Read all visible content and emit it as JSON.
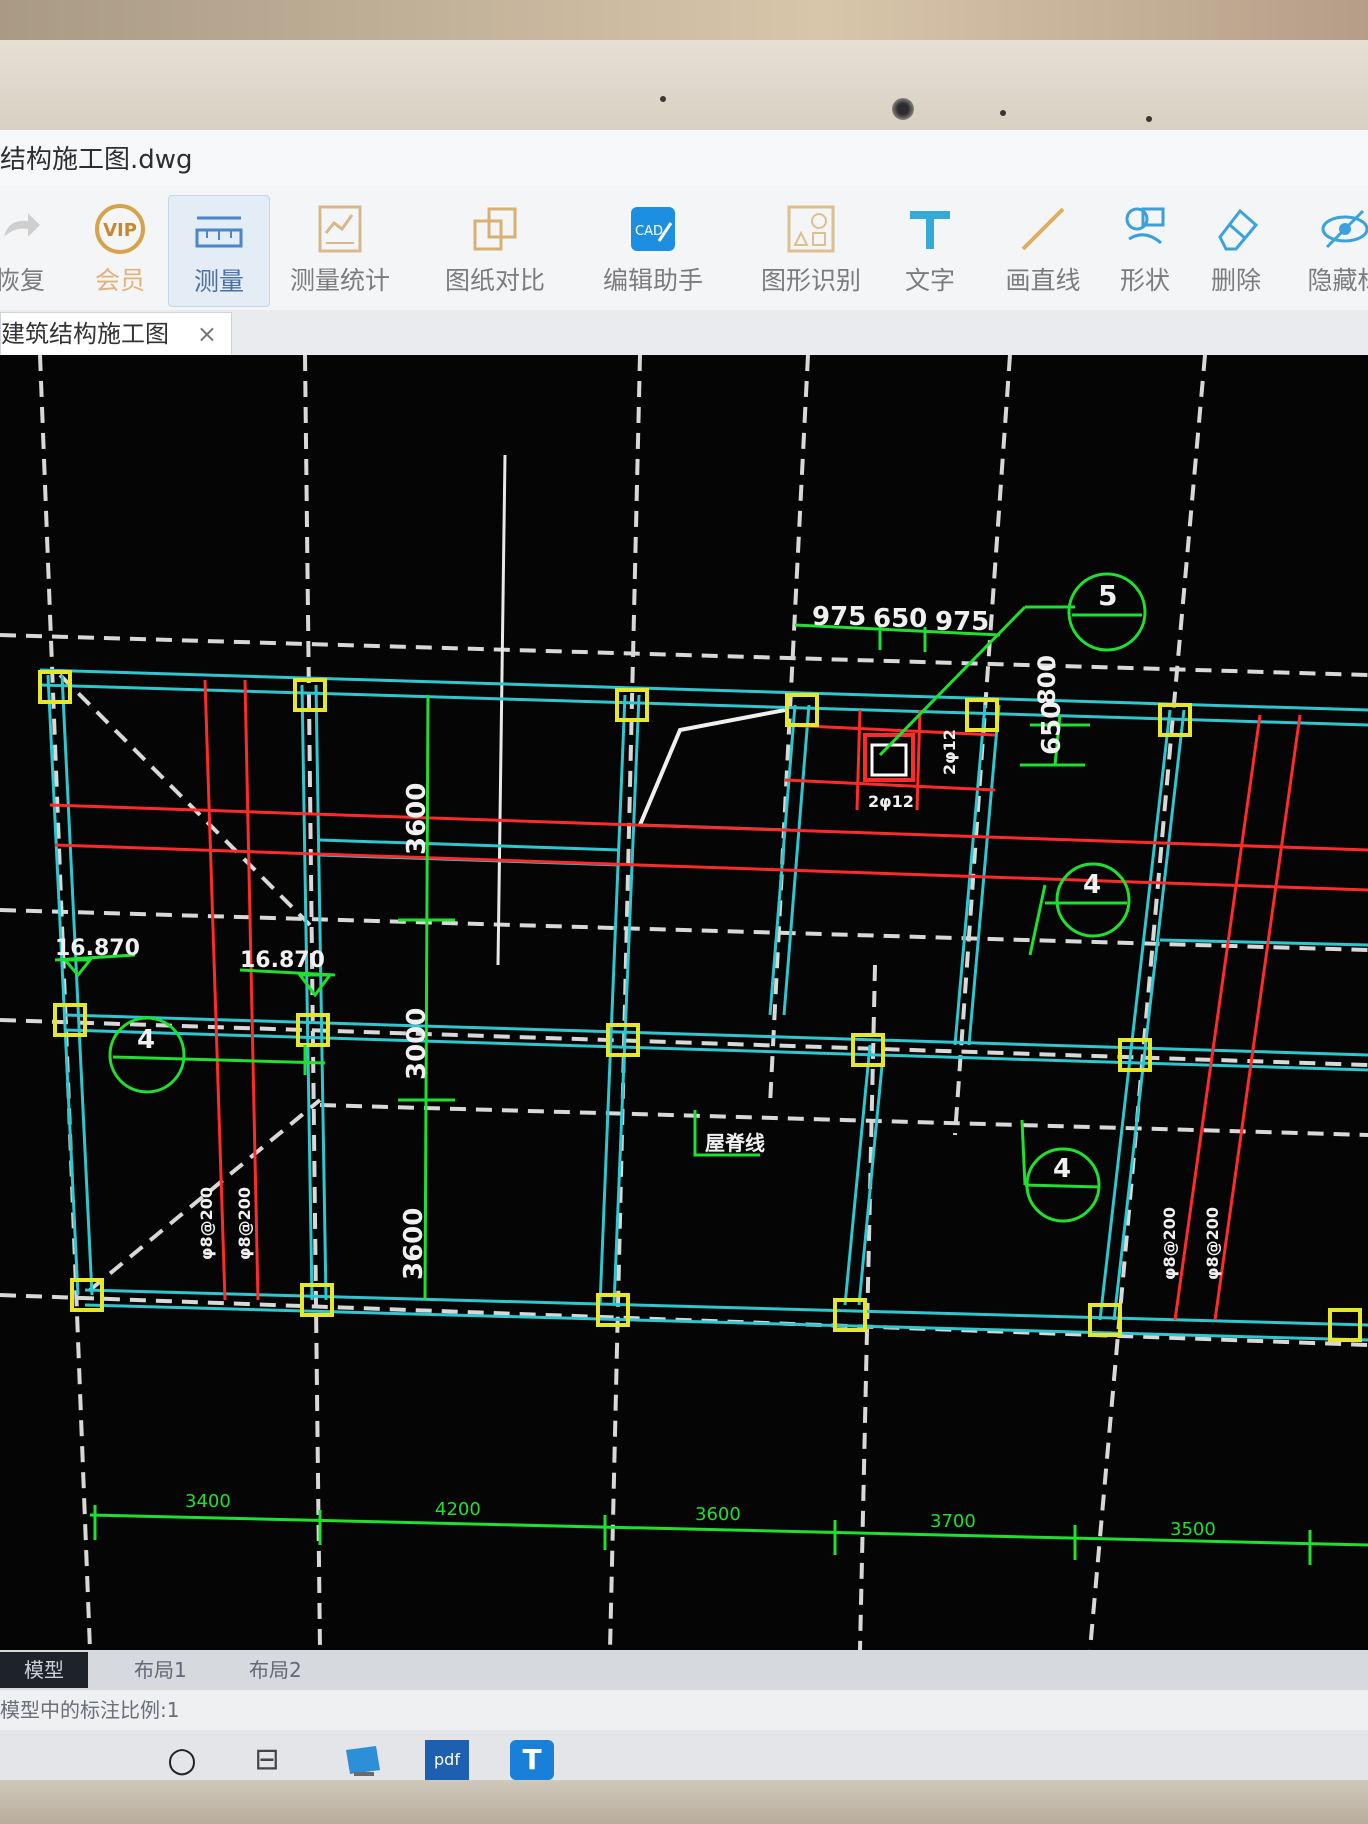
{
  "window": {
    "title": "结构施工图.dwg"
  },
  "toolbar": {
    "items": [
      {
        "label": "恢复",
        "icon": "redo-icon"
      },
      {
        "label": "会员",
        "icon": "vip-icon",
        "badge": "VIP"
      },
      {
        "label": "测量",
        "icon": "ruler-icon",
        "active": true
      },
      {
        "label": "测量统计",
        "icon": "measure-stats-icon"
      },
      {
        "label": "图纸对比",
        "icon": "compare-icon"
      },
      {
        "label": "编辑助手",
        "icon": "edit-assistant-icon",
        "badge": "CAD"
      },
      {
        "label": "图形识别",
        "icon": "shape-recognition-icon"
      },
      {
        "label": "文字",
        "icon": "text-icon"
      },
      {
        "label": "画直线",
        "icon": "line-icon"
      },
      {
        "label": "形状",
        "icon": "shapes-icon"
      },
      {
        "label": "删除",
        "icon": "eraser-icon"
      },
      {
        "label": "隐藏标",
        "icon": "hide-icon"
      }
    ]
  },
  "document_tab": {
    "label": "建筑结构施工图",
    "close": "×"
  },
  "drawing": {
    "dims_top": [
      "975",
      "650",
      "975"
    ],
    "dim_650": "650",
    "dim_800": "800",
    "dims_vertical": [
      "3600",
      "3000",
      "3600"
    ],
    "elevations": [
      "16.870",
      "16.870"
    ],
    "section_markers": [
      "5",
      "4",
      "4",
      "4"
    ],
    "column_labels": [
      "2φ12",
      "2φ12"
    ],
    "ridge_label": "屋脊线",
    "rebar_labels": [
      "φ8@200",
      "φ8@200",
      "φ8@200",
      "φ8@200"
    ],
    "bottom_dims": [
      "3400",
      "4200",
      "3600",
      "3700",
      "3500"
    ]
  },
  "layout_tabs": [
    "模型",
    "布局1",
    "布局2"
  ],
  "status": {
    "text": "模型中的标注比例:1"
  },
  "taskbar": {
    "items": [
      {
        "name": "search-circle-icon",
        "glyph": "○"
      },
      {
        "name": "task-view-icon",
        "glyph": "⊟"
      },
      {
        "name": "desktop-app-icon",
        "glyph": ""
      },
      {
        "name": "pdf-app-icon",
        "glyph": "pdf"
      },
      {
        "name": "text-app-icon",
        "glyph": "T"
      }
    ]
  },
  "colors": {
    "canvas": "#050505",
    "beam": "#2fc7cf",
    "grid_axis": "#d8d8d8",
    "rebar": "#ff2a2a",
    "annotation": "#1fe02f",
    "node": "#e6e72c"
  }
}
